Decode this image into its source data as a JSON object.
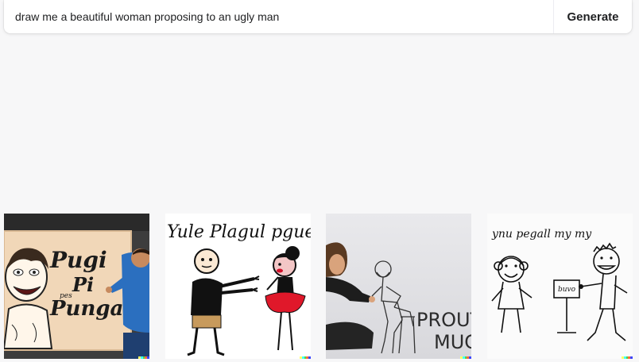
{
  "prompt": {
    "value": "draw me a beautiful woman proposing to an ugly man",
    "placeholder": "",
    "generate_label": "Generate"
  },
  "images": [
    {
      "icon": "image-thumbnail",
      "lettering": "Pugi Pi Punga"
    },
    {
      "icon": "image-thumbnail",
      "lettering": "Yule Plagul pgue"
    },
    {
      "icon": "image-thumbnail",
      "lettering": "PROUT MUG"
    },
    {
      "icon": "image-thumbnail",
      "lettering": "ynu pegall my my buvo"
    }
  ],
  "colors": {
    "page_background": "#f7f7f8",
    "signature": [
      "#ffff66",
      "#42ffff",
      "#51da4c",
      "#ff6e3c",
      "#3c46ff"
    ]
  }
}
